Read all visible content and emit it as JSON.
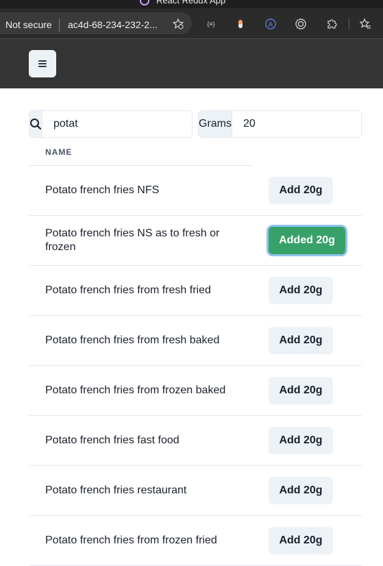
{
  "browser": {
    "tab_title": "React Redux App",
    "security_label": "Not secure",
    "url": "ac4d-68-234-232-2..."
  },
  "search": {
    "value": "potat",
    "icon": "search-icon"
  },
  "grams": {
    "label": "Grams",
    "value": "20"
  },
  "table": {
    "column_header": "NAME",
    "rows": [
      {
        "name": "Potato french fries NFS",
        "button": "Add 20g",
        "added": false
      },
      {
        "name": "Potato french fries NS as to fresh or frozen",
        "button": "Added 20g",
        "added": true
      },
      {
        "name": "Potato french fries from fresh fried",
        "button": "Add 20g",
        "added": false
      },
      {
        "name": "Potato french fries from fresh baked",
        "button": "Add 20g",
        "added": false
      },
      {
        "name": "Potato french fries from frozen baked",
        "button": "Add 20g",
        "added": false
      },
      {
        "name": "Potato french fries fast food",
        "button": "Add 20g",
        "added": false
      },
      {
        "name": "Potato french fries restaurant",
        "button": "Add 20g",
        "added": false
      },
      {
        "name": "Potato french fries from frozen fried",
        "button": "Add 20g",
        "added": false
      }
    ]
  },
  "colors": {
    "header_bg": "#343434",
    "added_green": "#38a169",
    "button_gray": "#edf2f7"
  }
}
